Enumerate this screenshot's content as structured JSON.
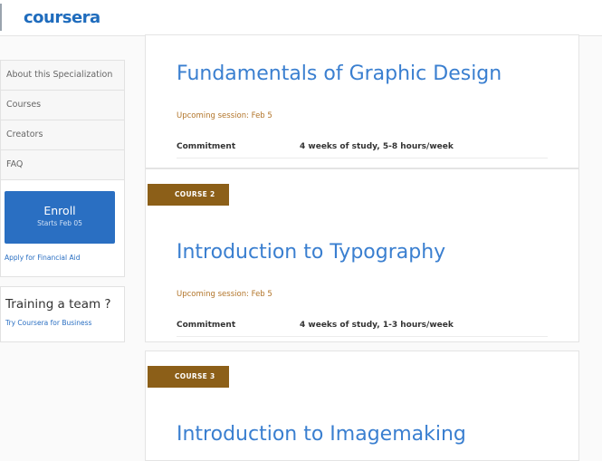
{
  "header": {
    "logo_text": "coursera"
  },
  "sidebar": {
    "items": [
      {
        "label": "About this Specialization"
      },
      {
        "label": "Courses"
      },
      {
        "label": "Creators"
      },
      {
        "label": "FAQ"
      }
    ],
    "enroll": {
      "label": "Enroll",
      "sub": "Starts Feb 05",
      "financial_aid": "Apply for Financial Aid"
    },
    "team": {
      "title": "Training a team ?",
      "link": "Try Coursera for Business"
    }
  },
  "courses": [
    {
      "badge": "",
      "title": "Fundamentals of Graphic Design",
      "session": "Upcoming session: Feb 5",
      "commitment_label": "Commitment",
      "commitment_value": "4 weeks of study, 5-8 hours/week"
    },
    {
      "badge": "COURSE 2",
      "title": "Introduction to Typography",
      "session": "Upcoming session: Feb 5",
      "commitment_label": "Commitment",
      "commitment_value": "4 weeks of study, 1-3 hours/week"
    },
    {
      "badge": "COURSE 3",
      "title": "Introduction to Imagemaking"
    }
  ],
  "colors": {
    "brand": "#1f6cbd",
    "badge": "#8c5f18",
    "session": "#b2752a",
    "link": "#2a6fc2"
  }
}
